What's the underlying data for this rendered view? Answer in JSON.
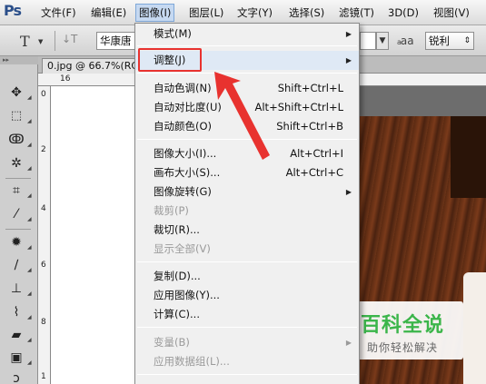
{
  "app": {
    "logo": "Ps"
  },
  "menubar": {
    "items": [
      {
        "label": "文件(F)",
        "active": false
      },
      {
        "label": "编辑(E)",
        "active": false
      },
      {
        "label": "图像(I)",
        "active": true
      },
      {
        "label": "图层(L)",
        "active": false
      },
      {
        "label": "文字(Y)",
        "active": false
      },
      {
        "label": "选择(S)",
        "active": false
      },
      {
        "label": "滤镜(T)",
        "active": false
      },
      {
        "label": "3D(D)",
        "active": false
      },
      {
        "label": "视图(V)",
        "active": false
      }
    ]
  },
  "options": {
    "tool_glyph": "T",
    "orient_glyph": "↓T",
    "font_family": "华康唐",
    "aa_glyph": "a",
    "aa_label": "aa",
    "aa_mode": "锐利"
  },
  "document": {
    "tab_title": "0.jpg @ 66.7%(RG"
  },
  "ruler": {
    "top": [
      "16"
    ],
    "left": [
      "0",
      "2",
      "4",
      "6",
      "8",
      "1"
    ]
  },
  "image_menu": {
    "items": [
      {
        "label": "模式(M)",
        "shortcut": "",
        "submenu": true,
        "disabled": false
      },
      {
        "label": "调整(J)",
        "shortcut": "",
        "submenu": true,
        "disabled": false
      },
      {
        "label": "自动色调(N)",
        "shortcut": "Shift+Ctrl+L",
        "submenu": false,
        "disabled": false
      },
      {
        "label": "自动对比度(U)",
        "shortcut": "Alt+Shift+Ctrl+L",
        "submenu": false,
        "disabled": false
      },
      {
        "label": "自动颜色(O)",
        "shortcut": "Shift+Ctrl+B",
        "submenu": false,
        "disabled": false
      },
      {
        "label": "图像大小(I)...",
        "shortcut": "Alt+Ctrl+I",
        "submenu": false,
        "disabled": false
      },
      {
        "label": "画布大小(S)...",
        "shortcut": "Alt+Ctrl+C",
        "submenu": false,
        "disabled": false
      },
      {
        "label": "图像旋转(G)",
        "shortcut": "",
        "submenu": true,
        "disabled": false
      },
      {
        "label": "裁剪(P)",
        "shortcut": "",
        "submenu": false,
        "disabled": true
      },
      {
        "label": "裁切(R)...",
        "shortcut": "",
        "submenu": false,
        "disabled": false
      },
      {
        "label": "显示全部(V)",
        "shortcut": "",
        "submenu": false,
        "disabled": true
      },
      {
        "label": "复制(D)...",
        "shortcut": "",
        "submenu": false,
        "disabled": false
      },
      {
        "label": "应用图像(Y)...",
        "shortcut": "",
        "submenu": false,
        "disabled": false
      },
      {
        "label": "计算(C)...",
        "shortcut": "",
        "submenu": false,
        "disabled": false
      },
      {
        "label": "变量(B)",
        "shortcut": "",
        "submenu": true,
        "disabled": true
      },
      {
        "label": "应用数据组(L)...",
        "shortcut": "",
        "submenu": false,
        "disabled": true
      }
    ]
  },
  "watermark": {
    "title": "百科全说",
    "subtitle": "助你轻松解决"
  },
  "colors": {
    "accent_red": "#e8322f",
    "menu_highlight": "#c6d9f1",
    "watermark_green": "#3bb54a"
  }
}
